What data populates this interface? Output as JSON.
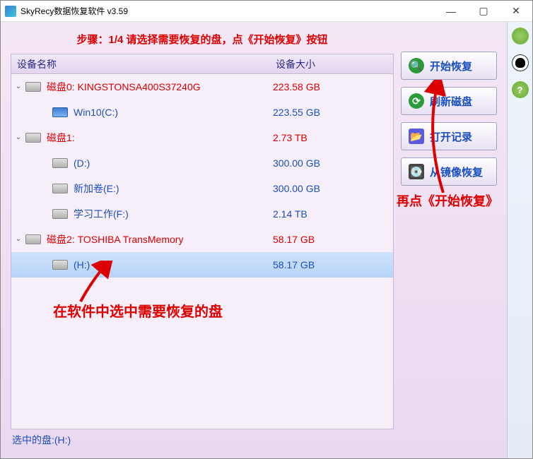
{
  "window": {
    "title": "SkyRecy数据恢复软件 v3.59"
  },
  "step_banner": "步骤：1/4 请选择需要恢复的盘，点《开始恢复》按钮",
  "columns": {
    "name": "设备名称",
    "size": "设备大小"
  },
  "tree": [
    {
      "type": "disk",
      "indent": 0,
      "chev": true,
      "icon": "drive",
      "label": "磁盘0: KINGSTONSA400S37240G",
      "size": "223.58 GB",
      "selected": false
    },
    {
      "type": "vol",
      "indent": 1,
      "chev": false,
      "icon": "win",
      "label": "Win10(C:)",
      "size": "223.55 GB",
      "selected": false
    },
    {
      "type": "disk",
      "indent": 0,
      "chev": true,
      "icon": "drive",
      "label": "磁盘1:",
      "size": "2.73 TB",
      "selected": false
    },
    {
      "type": "vol",
      "indent": 1,
      "chev": false,
      "icon": "drive",
      "label": "(D:)",
      "size": "300.00 GB",
      "selected": false
    },
    {
      "type": "vol",
      "indent": 1,
      "chev": false,
      "icon": "drive",
      "label": "新加卷(E:)",
      "size": "300.00 GB",
      "selected": false
    },
    {
      "type": "vol",
      "indent": 1,
      "chev": false,
      "icon": "drive",
      "label": "学习工作(F:)",
      "size": "2.14 TB",
      "selected": false
    },
    {
      "type": "disk",
      "indent": 0,
      "chev": true,
      "icon": "drive",
      "label": "磁盘2: TOSHIBA  TransMemory",
      "size": "58.17 GB",
      "selected": false
    },
    {
      "type": "vol",
      "indent": 1,
      "chev": false,
      "icon": "drive",
      "label": "(H:)",
      "size": "58.17 GB",
      "selected": true
    }
  ],
  "buttons": {
    "start": "开始恢复",
    "refresh": "刷新磁盘",
    "open": "打开记录",
    "image": "从镜像恢复"
  },
  "statusbar": "选中的盘:(H:)",
  "annotations": {
    "caption1": "再点《开始恢复》",
    "caption2": "在软件中选中需要恢复的盘"
  }
}
